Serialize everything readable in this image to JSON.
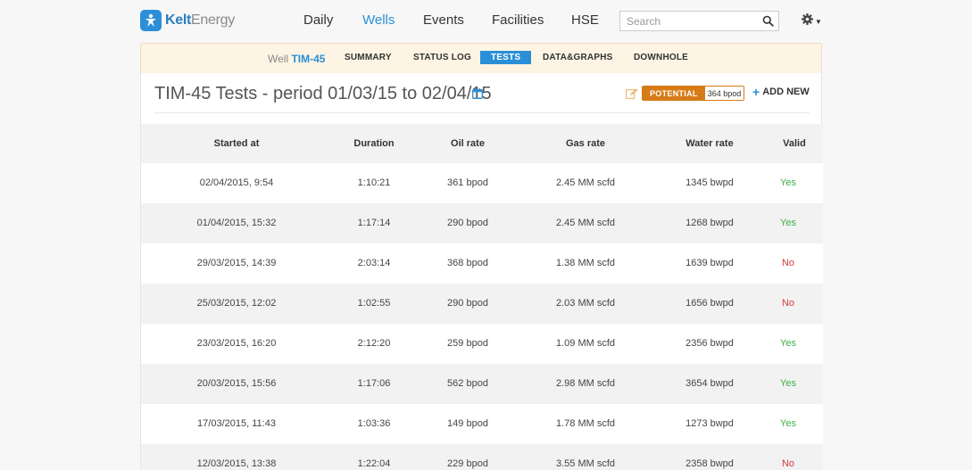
{
  "brand": {
    "name_part1": "Kelt",
    "name_part2": "Energy"
  },
  "nav": {
    "items": [
      {
        "label": "Daily"
      },
      {
        "label": "Wells"
      },
      {
        "label": "Events"
      },
      {
        "label": "Facilities"
      },
      {
        "label": "HSE"
      }
    ],
    "active": "Wells",
    "search_placeholder": "Search"
  },
  "subnav": {
    "well_prefix": "Well",
    "well_name": "TIM-45",
    "tabs": [
      {
        "label": "SUMMARY"
      },
      {
        "label": "STATUS LOG"
      },
      {
        "label": "TESTS"
      },
      {
        "label": "DATA&GRAPHS"
      },
      {
        "label": "DOWNHOLE"
      }
    ],
    "active": "TESTS"
  },
  "page": {
    "title": "TIM-45 Tests - period 01/03/15 to 02/04/15",
    "potential_label": "POTENTIAL",
    "potential_value": "364 bpod",
    "add_new_label": "ADD NEW"
  },
  "table": {
    "headers": [
      "Started at",
      "Duration",
      "Oil rate",
      "Gas rate",
      "Water rate",
      "Valid"
    ],
    "rows": [
      [
        "02/04/2015, 9:54",
        "1:10:21",
        "361 bpod",
        "2.45 MM scfd",
        "1345 bwpd",
        "Yes"
      ],
      [
        "01/04/2015, 15:32",
        "1:17:14",
        "290 bpod",
        "2.45 MM scfd",
        "1268 bwpd",
        "Yes"
      ],
      [
        "29/03/2015, 14:39",
        "2:03:14",
        "368 bpod",
        "1.38 MM scfd",
        "1639 bwpd",
        "No"
      ],
      [
        "25/03/2015, 12:02",
        "1:02:55",
        "290 bpod",
        "2.03 MM scfd",
        "1656 bwpd",
        "No"
      ],
      [
        "23/03/2015, 16:20",
        "2:12:20",
        "259 bpod",
        "1.09 MM scfd",
        "2356 bwpd",
        "Yes"
      ],
      [
        "20/03/2015, 15:56",
        "1:17:06",
        "562 bpod",
        "2.98 MM scfd",
        "3654 bwpd",
        "Yes"
      ],
      [
        "17/03/2015, 11:43",
        "1:03:36",
        "149 bpod",
        "1.78 MM scfd",
        "1273 bwpd",
        "Yes"
      ],
      [
        "12/03/2015, 13:38",
        "1:22:04",
        "229 bpod",
        "3.55 MM scfd",
        "2358 bwpd",
        "No"
      ]
    ]
  },
  "colors": {
    "accent": "#2a8fd6",
    "potential": "#d67b16",
    "valid_yes": "#3cb043",
    "valid_no": "#d63a3a"
  },
  "icons": {
    "search": "search-icon",
    "settings": "gear-icon",
    "calendar": "calendar-icon",
    "edit": "edit-icon",
    "add": "plus-icon"
  }
}
